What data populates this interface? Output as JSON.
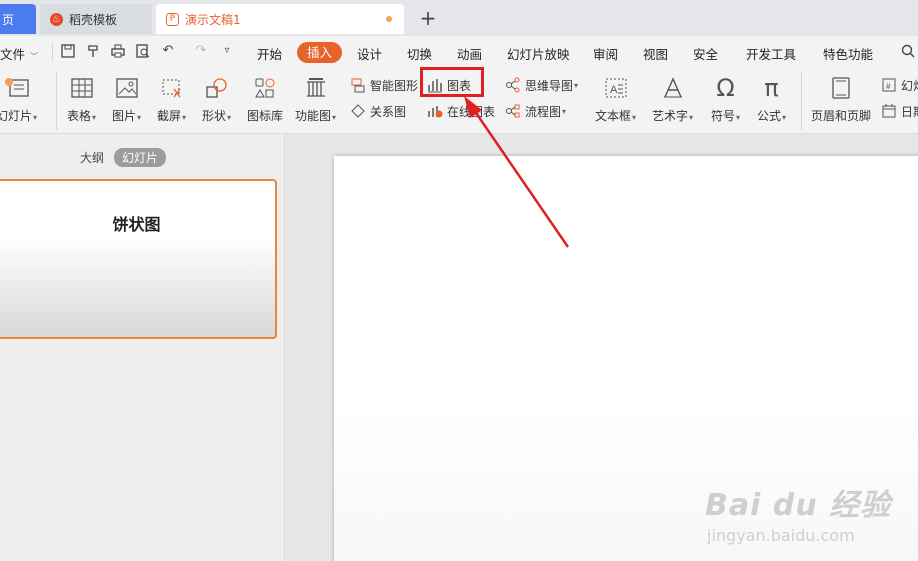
{
  "tabs": {
    "home_label": "页",
    "template_label": "稻壳模板",
    "doc_label": "演示文稿1",
    "new_tab": "+"
  },
  "menu": {
    "file": "文件",
    "items": [
      "开始",
      "插入",
      "设计",
      "切换",
      "动画",
      "幻灯片放映",
      "审阅",
      "视图",
      "安全",
      "开发工具",
      "特色功能"
    ],
    "active": "插入",
    "search_icon": "search-icon"
  },
  "ribbon": {
    "new_slide": "幻灯片",
    "table": "表格",
    "picture": "图片",
    "screenshot": "截屏",
    "shape": "形状",
    "icon_lib": "图标库",
    "function_chart": "功能图",
    "smart_art": "智能图形",
    "relation": "关系图",
    "chart": "图表",
    "online_chart": "在线图表",
    "mind_map": "思维导图",
    "flowchart": "流程图",
    "textbox": "文本框",
    "wordart": "艺术字",
    "symbol": "符号",
    "formula": "公式",
    "header_footer": "页眉和页脚",
    "slide_number_partial": "幻灯",
    "date_partial": "日期"
  },
  "leftpanel": {
    "outline": "大纲",
    "slides": "幻灯片",
    "thumb_title": "饼状图"
  },
  "watermark": {
    "main": "Bai du 经验",
    "sub": "jingyan.baidu.com"
  },
  "colors": {
    "accent": "#e8632a",
    "highlight": "#e02020",
    "tab_home": "#4b7bec"
  }
}
